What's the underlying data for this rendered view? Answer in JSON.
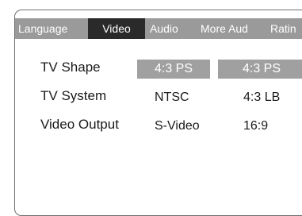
{
  "tabs": [
    {
      "label": "Language",
      "active": false
    },
    {
      "label": "Video",
      "active": true
    },
    {
      "label": "Audio",
      "active": false
    },
    {
      "label": "More Aud",
      "active": false
    },
    {
      "label": "Ratin",
      "active": false
    }
  ],
  "settings": [
    {
      "label": "TV Shape",
      "value": "4:3 PS"
    },
    {
      "label": "TV System",
      "value": "NTSC"
    },
    {
      "label": "Video Output",
      "value": "S-Video"
    }
  ],
  "options": [
    "4:3 PS",
    "4:3 LB",
    "16:9"
  ],
  "colors": {
    "tab_bar": "#9a9a9a",
    "active_tab": "#2a2a2a",
    "highlight": "#a0a0a0",
    "border": "#6e6e6e"
  }
}
